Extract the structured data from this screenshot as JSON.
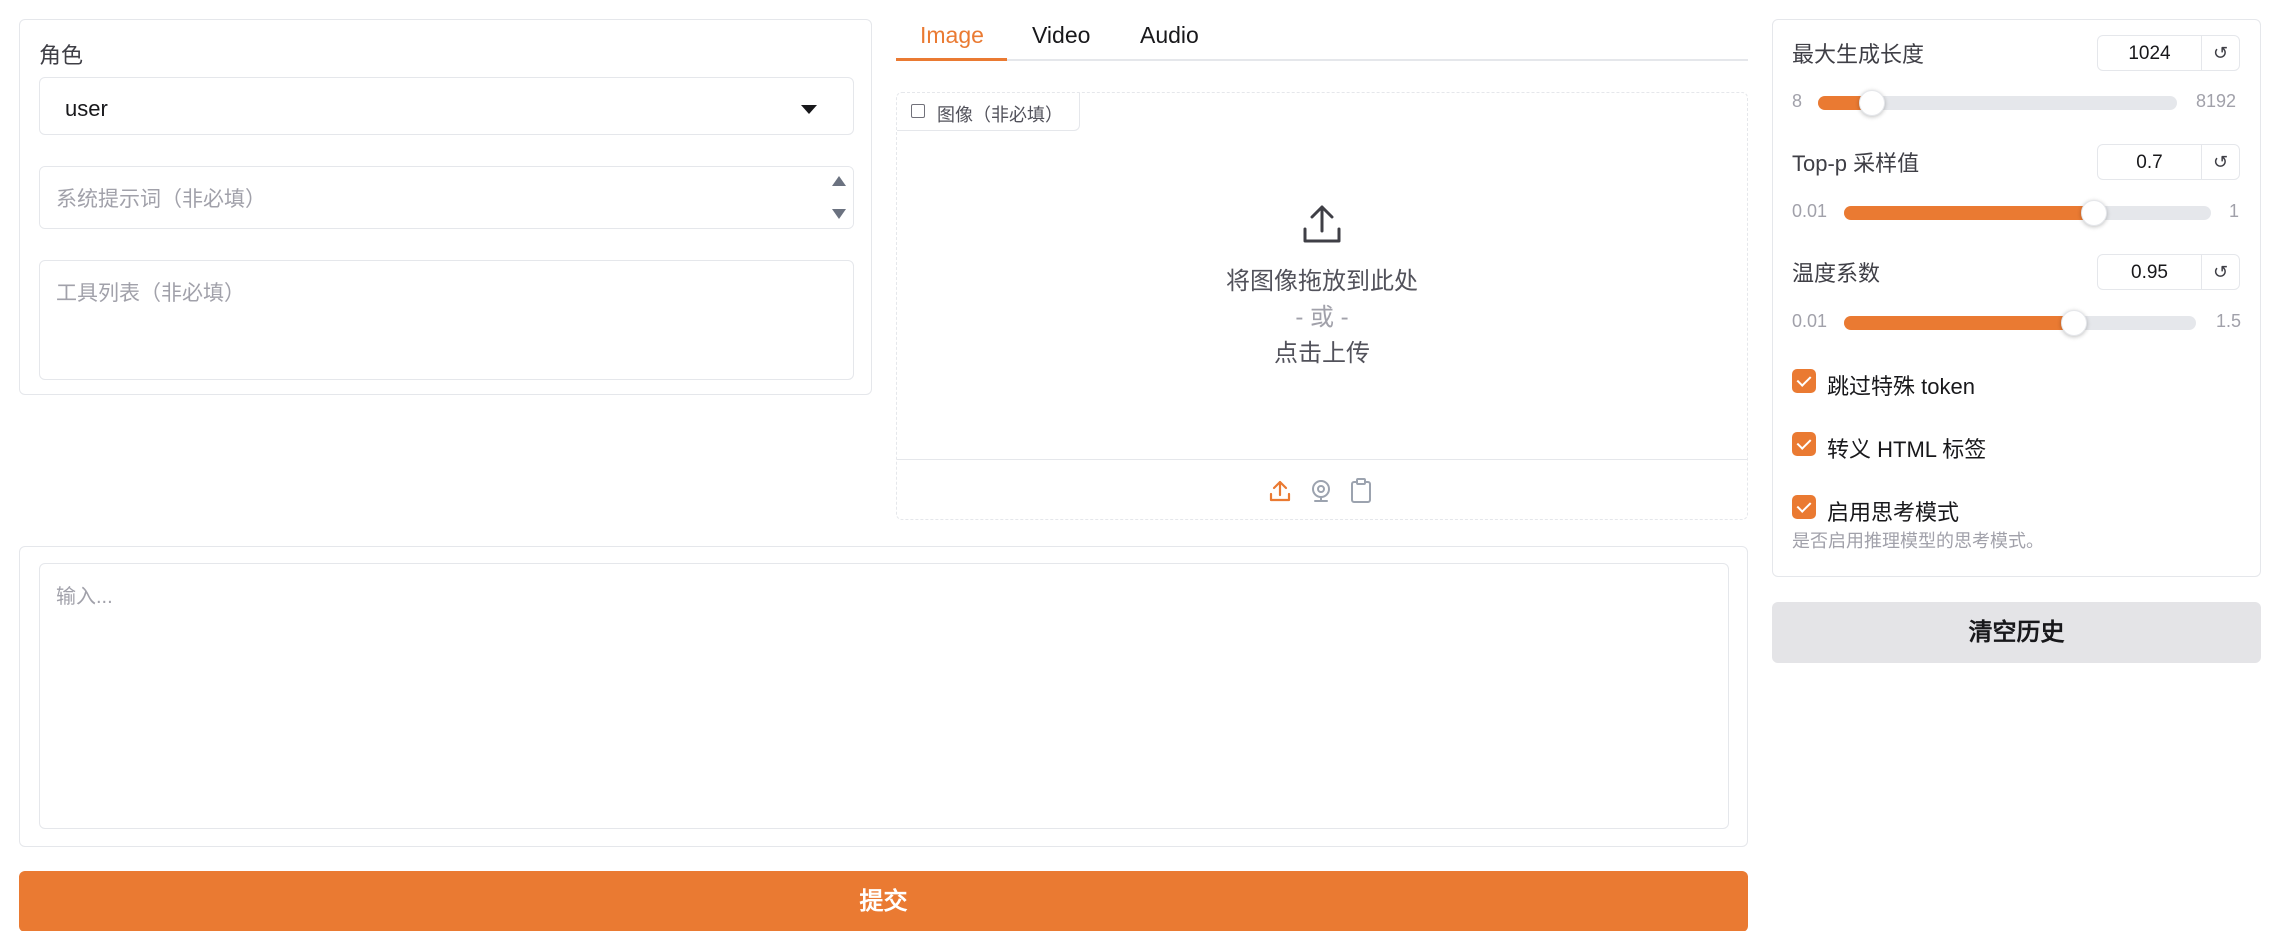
{
  "left": {
    "role_label": "角色",
    "role_value": "user",
    "system_prompt_placeholder": "系统提示词（非必填）",
    "tools_placeholder": "工具列表（非必填）"
  },
  "tabs": [
    {
      "label": "Image",
      "active": true
    },
    {
      "label": "Video",
      "active": false
    },
    {
      "label": "Audio",
      "active": false
    }
  ],
  "upload": {
    "label": "图像（非必填）",
    "drop_text": "将图像拖放到此处",
    "or_text": "- 或 -",
    "click_text": "点击上传",
    "footer_icons": [
      "upload-icon",
      "webcam-icon",
      "clipboard-icon"
    ]
  },
  "settings": {
    "max_length": {
      "label": "最大生成长度",
      "value": "1024",
      "min": "8",
      "max": "8192"
    },
    "top_p": {
      "label": "Top-p 采样值",
      "value": "0.7",
      "min": "0.01",
      "max": "1"
    },
    "temperature": {
      "label": "温度系数",
      "value": "0.95",
      "min": "0.01",
      "max": "1.5"
    },
    "reset_symbol": "↺",
    "skip_special": {
      "label": "跳过特殊 token",
      "checked": true
    },
    "escape_html": {
      "label": "转义 HTML 标签",
      "checked": true
    },
    "thinking": {
      "label": "启用思考模式",
      "checked": true,
      "hint": "是否启用推理模型的思考模式。"
    }
  },
  "input_placeholder": "输入...",
  "buttons": {
    "clear": "清空历史",
    "submit": "提交"
  },
  "colors": {
    "accent": "#ea7a32",
    "border": "#e5e7eb",
    "secondary_button": "#e4e4e7"
  }
}
